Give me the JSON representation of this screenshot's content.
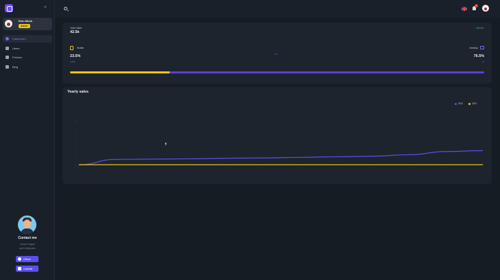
{
  "sidebar": {
    "user": {
      "name": "Elon Musk",
      "role": "Admin"
    },
    "items": [
      {
        "label": "Dashboard",
        "active": true
      },
      {
        "label": "Users",
        "active": false
      },
      {
        "label": "Product",
        "active": false
      },
      {
        "label": "Blog",
        "active": false
      }
    ],
    "contact": {
      "title": "Contact me",
      "line1": "Lemon Fraga2",
      "line2": "ant.101@ai.dev",
      "github_label": "Github",
      "linkedin_label": "Linkedin"
    }
  },
  "topbar": {
    "notification_count": "1"
  },
  "visits": {
    "label": "Total Visits",
    "value": "42.5k",
    "change": "+18.4%",
    "mobile": {
      "label": "Mobile",
      "percent": "23.5%",
      "count": "2,890",
      "fraction": 0.24
    },
    "desktop": {
      "label": "Desktop",
      "percent": "76.5%",
      "count": "22"
    },
    "vs": "VS",
    "colors": {
      "mobile": "#f0c419",
      "desktop": "#5b3fd9"
    }
  },
  "sales": {
    "title": "Yearly sales"
  },
  "chart_data": {
    "type": "line",
    "title": "Yearly sales",
    "categories": [
      "1",
      "2",
      "3",
      "4",
      "5",
      "6",
      "7",
      "8",
      "9",
      "10",
      "11",
      "12"
    ],
    "ylim": [
      0,
      180
    ],
    "series": [
      {
        "name": "2021",
        "color": "#5b4ef0",
        "values": [
          0,
          18,
          19,
          20,
          22,
          23,
          25,
          27,
          29,
          34,
          45,
          48
        ]
      },
      {
        "name": "2022",
        "color": "#f0c419",
        "values": [
          0,
          0,
          0,
          0,
          0,
          0,
          0,
          0,
          0,
          0,
          0,
          0
        ]
      }
    ],
    "grid": false,
    "legend": "top-right"
  }
}
